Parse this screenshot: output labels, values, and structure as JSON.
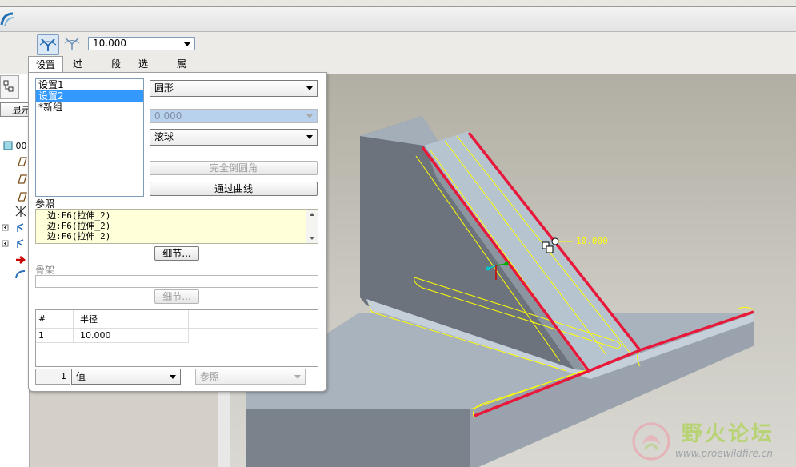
{
  "dashboard": {
    "value": "10.000",
    "tabs": [
      "设置",
      "过渡",
      "段",
      "选项",
      "属性"
    ]
  },
  "tree": {
    "tab_label": "显示",
    "root_label": "00"
  },
  "sets": {
    "items": [
      "设置1",
      "设置2",
      "*新组"
    ],
    "selected": 1
  },
  "settings": {
    "shape": "圆形",
    "value_field": "0.000",
    "method": "滚球",
    "full_round_button": "完全倒圆角",
    "through_curve_button": "通过曲线"
  },
  "references": {
    "label": "参照",
    "items": [
      "边:F6(拉伸_2)",
      "边:F6(拉伸_2)",
      "边:F6(拉伸_2)"
    ],
    "details_button": "细节..."
  },
  "skeleton": {
    "label": "骨架",
    "details_button": "细节..."
  },
  "radius_table": {
    "headers": [
      "#",
      "半径"
    ],
    "rows": [
      [
        "1",
        "10.000"
      ]
    ]
  },
  "bottom": {
    "index": "1",
    "mode": "值",
    "ref": "参照"
  },
  "viewport": {
    "dimension_label": "10.000"
  },
  "watermark": {
    "name": "野火论坛",
    "url": "www.proewildfire.cn"
  },
  "colors": {
    "selection": "#3399ff",
    "edge_red": "#e8183a",
    "highlight_yellow": "#ffff00"
  }
}
